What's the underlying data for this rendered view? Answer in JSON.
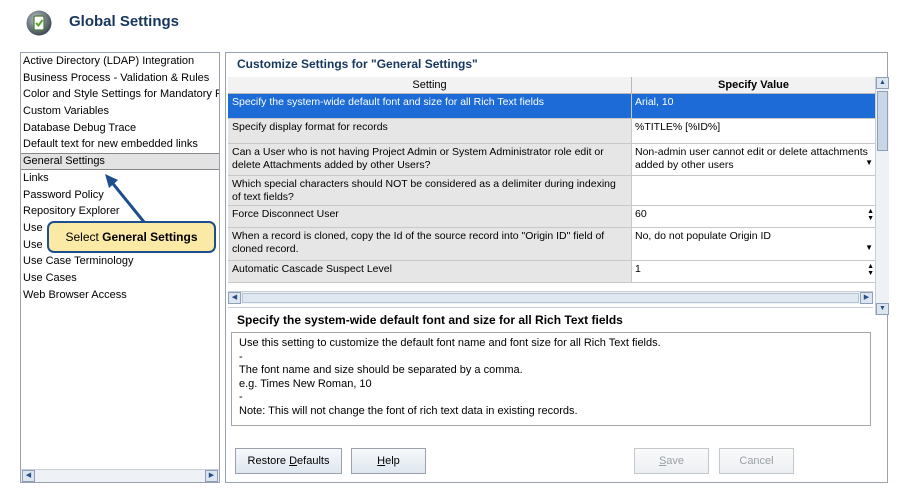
{
  "window": {
    "title": "Global Settings"
  },
  "left_list": {
    "items": [
      "Active Directory (LDAP) Integration",
      "Business Process - Validation & Rules",
      "Color and Style Settings for Mandatory Fie",
      "Custom Variables",
      "Database Debug Trace",
      "Default text for new embedded links",
      "General Settings",
      "Links",
      "Password Policy",
      "Repository Explorer",
      "Use",
      "Use",
      "Use Case Terminology",
      "Use Cases",
      "Web Browser Access"
    ],
    "selected_index": 6
  },
  "callout": {
    "prefix": "Select ",
    "bold": "General Settings"
  },
  "panel": {
    "title": "Customize Settings for \"General Settings\"",
    "columns": {
      "setting": "Setting",
      "value": "Specify Value"
    },
    "rows": [
      {
        "setting": "Specify the system-wide default font and size for all Rich Text fields",
        "value": "Arial, 10",
        "selected": true,
        "control": "none"
      },
      {
        "setting": "Specify display format for records",
        "value": "%TITLE% [%ID%]",
        "control": "none"
      },
      {
        "setting": "Can a User who is not having Project Admin or System Administrator role edit or delete Attachments added by other Users?",
        "value": "Non-admin user cannot edit or delete attachments added by other users",
        "control": "dropdown"
      },
      {
        "setting": "Which special characters should NOT be considered as a delimiter during indexing of text fields?",
        "value": "",
        "control": "none"
      },
      {
        "setting": "Force Disconnect User",
        "value": "60",
        "control": "spinner"
      },
      {
        "setting": "When a record is cloned, copy the Id of the source record into \"Origin ID\" field of cloned record.",
        "value": "No, do not populate Origin ID",
        "control": "dropdown"
      },
      {
        "setting": "Automatic Cascade Suspect Level",
        "value": "1",
        "control": "spinner"
      }
    ],
    "description": {
      "title": "Specify the system-wide default font and size for all Rich Text fields",
      "lines": [
        "Use this setting to customize the default font name and font size for all Rich Text fields.",
        "-",
        "The font name and size should be separated by a comma.",
        "e.g. Times New Roman, 10",
        "-",
        "Note: This will not change the font of rich text data in existing records."
      ]
    }
  },
  "buttons": {
    "restore": {
      "before": "Restore ",
      "key": "D",
      "after": "efaults"
    },
    "help": {
      "before": "",
      "key": "H",
      "after": "elp"
    },
    "save": {
      "before": "",
      "key": "S",
      "after": "ave"
    },
    "cancel": {
      "label": "Cancel"
    }
  },
  "icons": {
    "app": "app-logo-icon",
    "scroll_up": "scroll-up-icon",
    "scroll_down": "scroll-down-icon",
    "scroll_left": "scroll-left-icon",
    "scroll_right": "scroll-right-icon"
  },
  "colors": {
    "selection": "#1c6bd6",
    "title": "#17365d",
    "callout_bg": "#fbe9a6",
    "callout_border": "#1f4e8c"
  }
}
